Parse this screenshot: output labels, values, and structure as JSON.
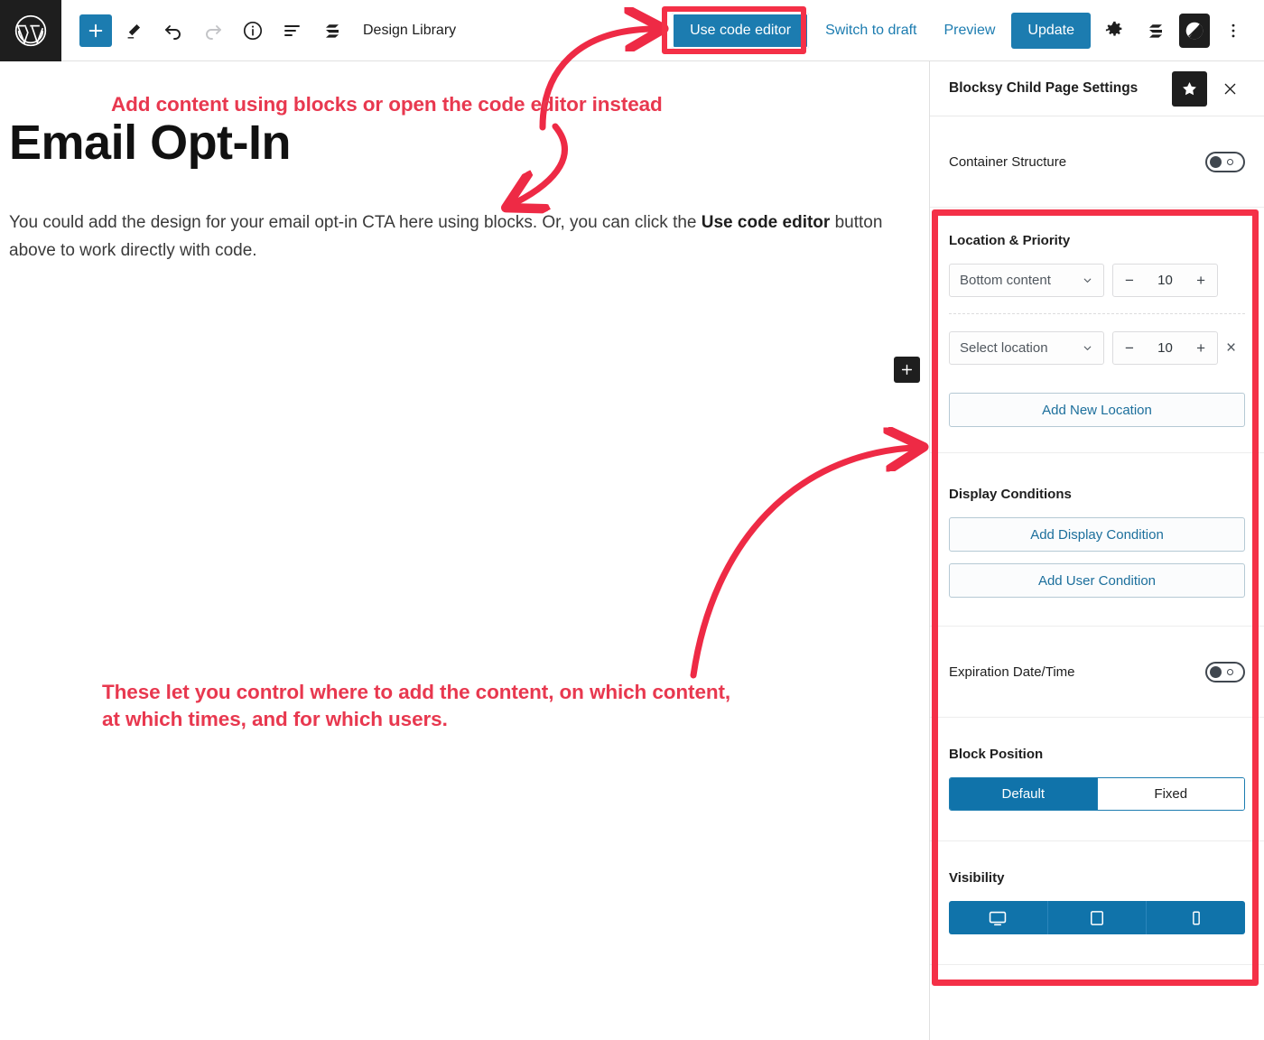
{
  "topbar": {
    "wp_logo": "wordpress-logo",
    "add_block_label": "+",
    "design_library_label": "Design Library",
    "icons": [
      "add-block-icon",
      "pencil-edit-icon",
      "undo-icon",
      "redo-icon",
      "info-icon",
      "list-view-icon",
      "stackable-logo-icon"
    ],
    "use_code_editor_label": "Use code editor",
    "switch_to_draft_label": "Switch to draft",
    "preview_label": "Preview",
    "update_label": "Update",
    "right_icons": [
      "settings-gear-icon",
      "stackable-logo-icon",
      "blocksy-logo-icon",
      "options-menu-icon"
    ]
  },
  "content": {
    "title": "Email Opt-In",
    "paragraph_part1": "You could add the design for your email opt-in CTA here using blocks. Or, you can click the ",
    "paragraph_bold": "Use code editor",
    "paragraph_part2": " button above to work directly with code.",
    "inserter_label": "+"
  },
  "sidebar": {
    "title": "Blocksy Child Page Settings",
    "star_icon": "star-icon",
    "close_icon": "close-icon",
    "container_structure": {
      "label": "Container Structure",
      "toggle_state": "off"
    },
    "location_priority": {
      "title": "Location & Priority",
      "rows": [
        {
          "location": "Bottom content",
          "priority": "10",
          "removable": false
        },
        {
          "location": "Select location",
          "priority": "10",
          "removable": true
        }
      ],
      "minus_label": "−",
      "plus_label": "+",
      "remove_label": "×",
      "add_new_location_label": "Add New Location"
    },
    "display_conditions": {
      "title": "Display Conditions",
      "add_display_condition_label": "Add Display Condition",
      "add_user_condition_label": "Add User Condition"
    },
    "expiration": {
      "label": "Expiration Date/Time",
      "toggle_state": "off"
    },
    "block_position": {
      "title": "Block Position",
      "options": [
        "Default",
        "Fixed"
      ],
      "selected": "Default"
    },
    "visibility": {
      "title": "Visibility",
      "devices": [
        "desktop-icon",
        "tablet-icon",
        "mobile-icon"
      ],
      "all_enabled": true
    }
  },
  "annotations": {
    "top_note": "Add content using blocks or open the code editor instead",
    "bottom_note": "These let you control where to add the content, on which content,\nat which times, and for which users.",
    "highlight_color": "#f43047",
    "text_color": "#e8384f"
  },
  "colors": {
    "accent_blue": "#1c7cb0",
    "button_blue": "#1073aa",
    "link_blue": "#1c6f9c",
    "dark": "#1e1e1e",
    "annotation_red": "#f43047"
  }
}
